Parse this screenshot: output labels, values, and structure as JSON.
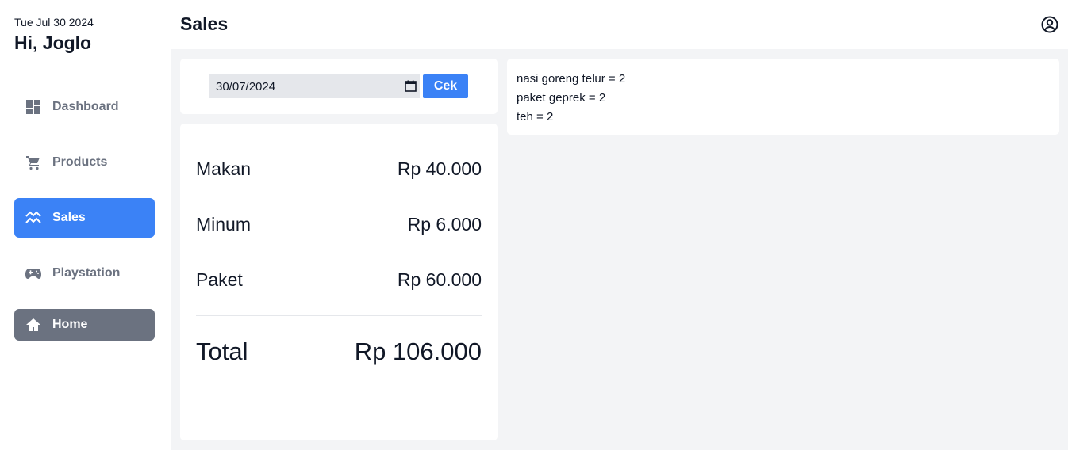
{
  "sidebar": {
    "date": "Tue Jul 30 2024",
    "greeting": "Hi, Joglo",
    "items": [
      {
        "label": "Dashboard",
        "icon": "dashboard-icon"
      },
      {
        "label": "Products",
        "icon": "cart-icon"
      },
      {
        "label": "Sales",
        "icon": "sales-chart-icon",
        "active": true
      },
      {
        "label": "Playstation",
        "icon": "gamepad-icon"
      },
      {
        "label": "Home",
        "icon": "home-icon"
      }
    ]
  },
  "header": {
    "title": "Sales",
    "account_icon": "account-circle-icon"
  },
  "date_filter": {
    "value": "30/07/2024",
    "button_label": "Cek",
    "icon": "calendar-icon"
  },
  "summary": {
    "rows": [
      {
        "label": "Makan",
        "value": "Rp 40.000"
      },
      {
        "label": "Minum",
        "value": "Rp 6.000"
      },
      {
        "label": "Paket",
        "value": "Rp 60.000"
      }
    ],
    "total": {
      "label": "Total",
      "value": "Rp 106.000"
    }
  },
  "items": [
    "nasi goreng telur = 2",
    "paket geprek = 2",
    "teh = 2"
  ],
  "colors": {
    "accent": "#3b82f6",
    "home": "#6b7280",
    "background": "#f3f4f6"
  }
}
